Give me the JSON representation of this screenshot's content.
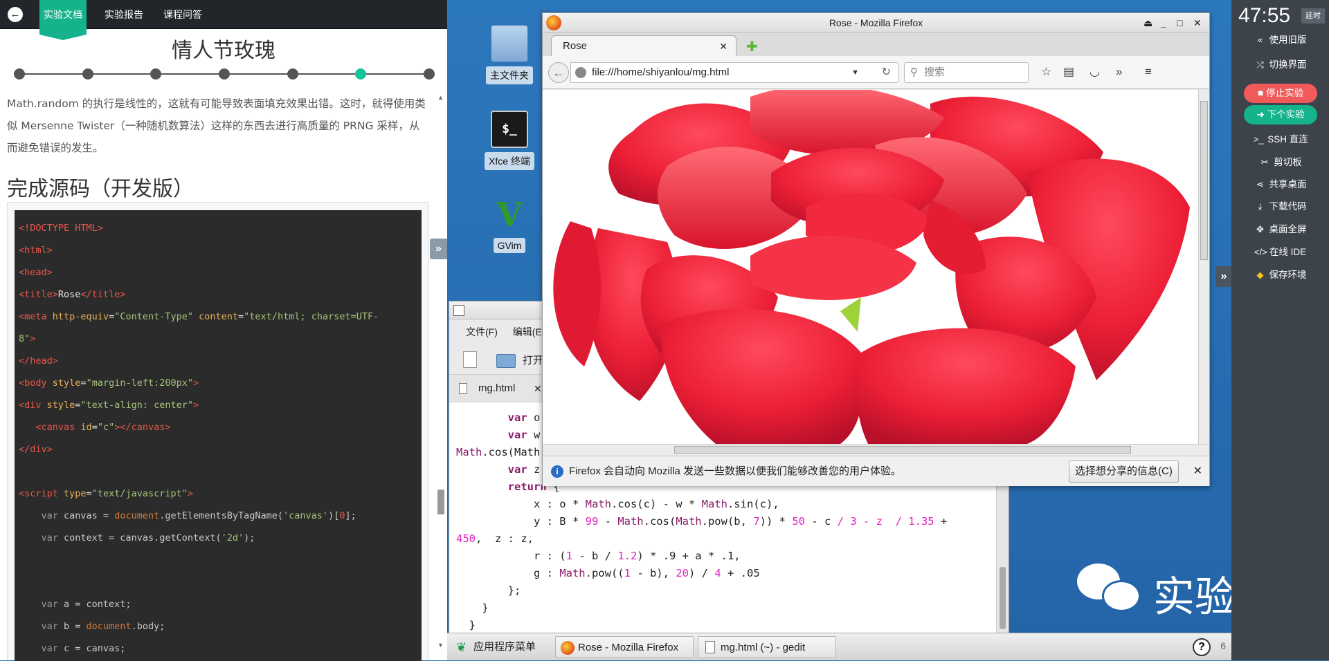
{
  "left_panel": {
    "tabs": [
      {
        "label": "实验文档",
        "active": true
      },
      {
        "label": "实验报告",
        "active": false
      },
      {
        "label": "课程问答",
        "active": false
      }
    ],
    "title": "情人节玫瑰",
    "progress": {
      "steps": 7,
      "current": 6
    },
    "paragraph": "Math.random 的执行是线性的，这就有可能导致表面填充效果出错。这时，就得使用类似 Mersenne Twister（一种随机数算法）这样的东西去进行高质量的 PRNG 采样，从而避免错误的发生。",
    "section_title": "完成源码（开发版）",
    "code_lines": [
      [
        {
          "c": "t-tag",
          "t": "<!DOCTYPE HTML>"
        }
      ],
      [
        {
          "c": "t-tag",
          "t": "<html>"
        }
      ],
      [
        {
          "c": "t-tag",
          "t": "<head>"
        }
      ],
      [
        {
          "c": "t-tag",
          "t": "<title>"
        },
        {
          "c": "t-txt",
          "t": "Rose"
        },
        {
          "c": "t-tag",
          "t": "</title>"
        }
      ],
      [
        {
          "c": "t-tag",
          "t": "<meta "
        },
        {
          "c": "t-attr",
          "t": "http-equiv"
        },
        {
          "c": "t-txt",
          "t": "="
        },
        {
          "c": "t-str",
          "t": "\"Content-Type\" "
        },
        {
          "c": "t-attr",
          "t": "content"
        },
        {
          "c": "t-txt",
          "t": "="
        },
        {
          "c": "t-str",
          "t": "\"text/html; charset=UTF-"
        }
      ],
      [
        {
          "c": "t-str",
          "t": "8\""
        },
        {
          "c": "t-tag",
          "t": ">"
        }
      ],
      [
        {
          "c": "t-tag",
          "t": "</head>"
        }
      ],
      [
        {
          "c": "t-tag",
          "t": "<body "
        },
        {
          "c": "t-attr",
          "t": "style"
        },
        {
          "c": "t-txt",
          "t": "="
        },
        {
          "c": "t-str",
          "t": "\"margin-left:200px\""
        },
        {
          "c": "t-tag",
          "t": ">"
        }
      ],
      [
        {
          "c": "t-tag",
          "t": "<div "
        },
        {
          "c": "t-attr",
          "t": "style"
        },
        {
          "c": "t-txt",
          "t": "="
        },
        {
          "c": "t-str",
          "t": "\"text-align: center\""
        },
        {
          "c": "t-tag",
          "t": ">"
        }
      ],
      [
        {
          "c": "t-txt",
          "t": "   "
        },
        {
          "c": "t-tag",
          "t": "<canvas "
        },
        {
          "c": "t-attr",
          "t": "id"
        },
        {
          "c": "t-txt",
          "t": "="
        },
        {
          "c": "t-str",
          "t": "\"c\""
        },
        {
          "c": "t-tag",
          "t": "></canvas>"
        }
      ],
      [
        {
          "c": "t-tag",
          "t": "</div>"
        }
      ],
      [],
      [
        {
          "c": "t-tag",
          "t": "<script "
        },
        {
          "c": "t-attr",
          "t": "type"
        },
        {
          "c": "t-txt",
          "t": "="
        },
        {
          "c": "t-str",
          "t": "\"text/javascript\""
        },
        {
          "c": "t-tag",
          "t": ">"
        }
      ],
      [
        {
          "c": "t-kw",
          "t": "    var "
        },
        {
          "c": "t-id",
          "t": "canvas = "
        },
        {
          "c": "t-obj",
          "t": "document"
        },
        {
          "c": "t-id",
          "t": ".getElementsByTagName("
        },
        {
          "c": "t-str2",
          "t": "'canvas'"
        },
        {
          "c": "t-id",
          "t": ")["
        },
        {
          "c": "t-num",
          "t": "0"
        },
        {
          "c": "t-id",
          "t": "];"
        }
      ],
      [
        {
          "c": "t-kw",
          "t": "    var "
        },
        {
          "c": "t-id",
          "t": "context = canvas.getContext("
        },
        {
          "c": "t-str2",
          "t": "'2d'"
        },
        {
          "c": "t-id",
          "t": ");"
        }
      ],
      [],
      [],
      [
        {
          "c": "t-kw",
          "t": "    var "
        },
        {
          "c": "t-id",
          "t": "a = context;"
        }
      ],
      [
        {
          "c": "t-kw",
          "t": "    var "
        },
        {
          "c": "t-id",
          "t": "b = "
        },
        {
          "c": "t-obj",
          "t": "document"
        },
        {
          "c": "t-id",
          "t": ".body;"
        }
      ],
      [
        {
          "c": "t-kw",
          "t": "    var "
        },
        {
          "c": "t-id",
          "t": "c = canvas;"
        }
      ]
    ]
  },
  "desktop": {
    "icons": [
      {
        "label": "主文件夹",
        "name": "home-folder-icon"
      },
      {
        "label": "Xfce 终端",
        "name": "terminal-icon"
      },
      {
        "label": "GVim",
        "name": "gvim-icon"
      }
    ],
    "watermark": "实验楼"
  },
  "firefox": {
    "window_title": "Rose - Mozilla Firefox",
    "tab_label": "Rose",
    "url": "file:///home/shiyanlou/mg.html",
    "search_placeholder": "搜索",
    "notification": "Firefox 会自动向 Mozilla 发送一些数据以便我们能够改善您的用户体验。",
    "notification_button": "选择想分享的信息(C)"
  },
  "gedit": {
    "menu": [
      "文件(F)",
      "编辑(E)"
    ],
    "toolbar_open": "打开",
    "tab_label": "mg.html",
    "lines": [
      [
        {
          "c": "",
          "t": "        "
        },
        {
          "c": "g-kw",
          "t": "var "
        },
        {
          "c": "",
          "t": "o"
        }
      ],
      [
        {
          "c": "",
          "t": "        "
        },
        {
          "c": "g-kw",
          "t": "var "
        },
        {
          "c": "",
          "t": "w"
        }
      ],
      [
        {
          "c": "g-fn",
          "t": "Math"
        },
        {
          "c": "",
          "t": ".cos(Math"
        }
      ],
      [
        {
          "c": "",
          "t": "        "
        },
        {
          "c": "g-kw",
          "t": "var "
        },
        {
          "c": "",
          "t": "z"
        }
      ],
      [
        {
          "c": "",
          "t": "        "
        },
        {
          "c": "g-kw",
          "t": "return "
        },
        {
          "c": "",
          "t": "{"
        }
      ],
      [
        {
          "c": "",
          "t": "            x : o * "
        },
        {
          "c": "g-fn",
          "t": "Math"
        },
        {
          "c": "",
          "t": ".cos(c) - w * "
        },
        {
          "c": "g-fn",
          "t": "Math"
        },
        {
          "c": "",
          "t": ".sin(c),"
        }
      ],
      [
        {
          "c": "",
          "t": "            y : B * "
        },
        {
          "c": "g-num",
          "t": "99"
        },
        {
          "c": "",
          "t": " - "
        },
        {
          "c": "g-fn",
          "t": "Math"
        },
        {
          "c": "",
          "t": ".cos("
        },
        {
          "c": "g-fn",
          "t": "Math"
        },
        {
          "c": "",
          "t": ".pow(b, "
        },
        {
          "c": "g-num",
          "t": "7"
        },
        {
          "c": "",
          "t": ")) * "
        },
        {
          "c": "g-num",
          "t": "50"
        },
        {
          "c": "",
          "t": " - c "
        },
        {
          "c": "g-num",
          "t": "/ 3 - z  / 1.35"
        },
        {
          "c": "",
          "t": " +"
        }
      ],
      [
        {
          "c": "g-num",
          "t": "450"
        },
        {
          "c": "",
          "t": ",  z : z,"
        }
      ],
      [
        {
          "c": "",
          "t": "            r : ("
        },
        {
          "c": "g-num",
          "t": "1"
        },
        {
          "c": "",
          "t": " - b / "
        },
        {
          "c": "g-num",
          "t": "1.2"
        },
        {
          "c": "",
          "t": ") * .9 + a * .1,"
        }
      ],
      [
        {
          "c": "",
          "t": "            g : "
        },
        {
          "c": "g-fn",
          "t": "Math"
        },
        {
          "c": "",
          "t": ".pow(("
        },
        {
          "c": "g-num",
          "t": "1"
        },
        {
          "c": "",
          "t": " - b), "
        },
        {
          "c": "g-num",
          "t": "20"
        },
        {
          "c": "",
          "t": ") / "
        },
        {
          "c": "g-num",
          "t": "4"
        },
        {
          "c": "",
          "t": " + .05"
        }
      ],
      [
        {
          "c": "",
          "t": "        };"
        }
      ],
      [
        {
          "c": "",
          "t": "    }"
        }
      ],
      [
        {
          "c": "",
          "t": "  }"
        }
      ]
    ]
  },
  "taskbar": {
    "menu_label": "应用程序菜单",
    "items": [
      "Rose - Mozilla Firefox",
      "mg.html (~) - gedit"
    ],
    "trailing": "6"
  },
  "right_panel": {
    "timer": "47:55",
    "extend_label": "延时",
    "items": [
      {
        "label": "使用旧版",
        "icon": "double-chevron-left-icon",
        "glyph": "«"
      },
      {
        "label": "切换界面",
        "icon": "shuffle-icon",
        "glyph": "⤮"
      },
      {
        "label": "停止实验",
        "pill": "#f05a5a",
        "icon": "stop-icon",
        "glyph": "■"
      },
      {
        "label": "下个实验",
        "pill": "#15b38b",
        "icon": "arrow-right-icon",
        "glyph": "➜"
      },
      {
        "label": "SSH 直连",
        "icon": "terminal-prompt-icon",
        "glyph": ">_"
      },
      {
        "label": "剪切板",
        "icon": "scissors-icon",
        "glyph": "✂"
      },
      {
        "label": "共享桌面",
        "icon": "share-icon",
        "glyph": "⋖"
      },
      {
        "label": "下载代码",
        "icon": "download-icon",
        "glyph": "⤓"
      },
      {
        "label": "桌面全屏",
        "icon": "fullscreen-icon",
        "glyph": "✥"
      },
      {
        "label": "在线 IDE",
        "icon": "code-icon",
        "glyph": "</>"
      },
      {
        "label": "保存环境",
        "icon": "gem-icon",
        "glyph": "◆"
      }
    ]
  },
  "colors": {
    "accent": "#15b38b",
    "danger": "#f05a5a",
    "panel": "#3c434b",
    "rose": "#e8213a"
  }
}
